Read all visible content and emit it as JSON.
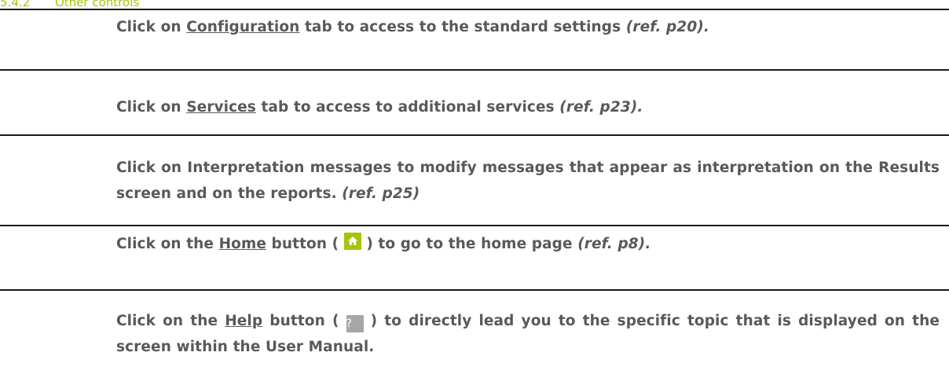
{
  "section": {
    "number": "5.4.2",
    "title": "Other controls"
  },
  "items": [
    {
      "prefix": "Click on ",
      "link": "Configuration",
      "middle": " tab to access to the standard settings ",
      "ref": "(ref. p20)."
    },
    {
      "prefix": "Click on ",
      "link": "Services",
      "middle": " tab to access to additional services ",
      "ref": "(ref. p23)."
    },
    {
      "text": "Click on Interpretation messages to modify messages that appear as interpretation on the Results screen and on the reports. ",
      "ref": "(ref. p25)"
    },
    {
      "prefix": "Click on the ",
      "link": "Home",
      "before_icon": " button (",
      "icon": "home-icon",
      "after_icon": ") to go to the home page ",
      "ref": "(ref. p8)."
    },
    {
      "prefix": "Click on the ",
      "link": "Help",
      "before_icon": " button (",
      "icon": "help-icon",
      "icon_glyph": "?",
      "after_icon": ") to directly lead you to the specific topic that is displayed on the screen within the User Manual."
    }
  ],
  "colors": {
    "heading": "#a8c40a",
    "text": "#595959",
    "home_icon_bg": "#a7c40c",
    "help_icon_bg": "#a6a6a6",
    "rule": "#1a1a1a"
  }
}
